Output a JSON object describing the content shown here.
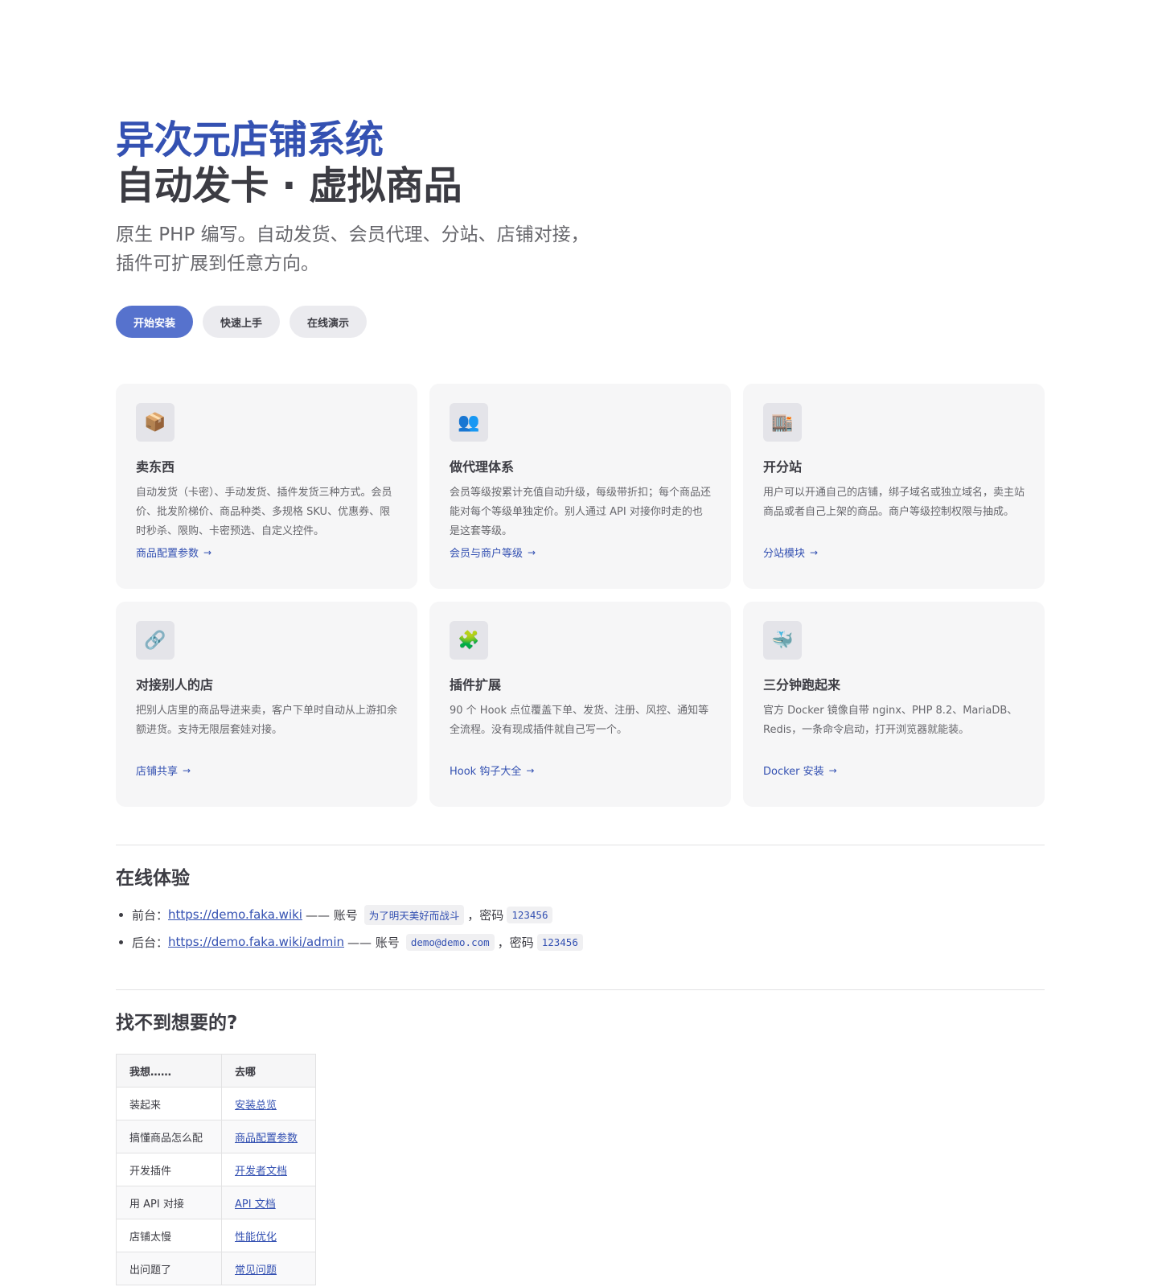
{
  "hero": {
    "name": "异次元店铺系统",
    "text": "自动发卡 · 虚拟商品",
    "tagline": "原生 PHP 编写。自动发货、会员代理、分站、店铺对接，插件可扩展到任意方向。",
    "actions": [
      {
        "label": "开始安装",
        "theme": "brand"
      },
      {
        "label": "快速上手",
        "theme": "alt"
      },
      {
        "label": "在线演示",
        "theme": "alt"
      }
    ]
  },
  "features": [
    {
      "icon": "📦",
      "icon_name": "package-icon",
      "title": "卖东西",
      "details": "自动发货（卡密）、手动发货、插件发货三种方式。会员价、批发阶梯价、商品种类、多规格 SKU、优惠券、限时秒杀、限购、卡密预选、自定义控件。",
      "link": "商品配置参数"
    },
    {
      "icon": "👥",
      "icon_name": "people-icon",
      "title": "做代理体系",
      "details": "会员等级按累计充值自动升级，每级带折扣；每个商品还能对每个等级单独定价。别人通过 API 对接你时走的也是这套等级。",
      "link": "会员与商户等级"
    },
    {
      "icon": "🏬",
      "icon_name": "store-icon",
      "title": "开分站",
      "details": "用户可以开通自己的店铺，绑子域名或独立域名，卖主站商品或者自己上架的商品。商户等级控制权限与抽成。",
      "link": "分站模块"
    },
    {
      "icon": "🔗",
      "icon_name": "link-icon",
      "title": "对接别人的店",
      "details": "把别人店里的商品导进来卖，客户下单时自动从上游扣余额进货。支持无限层套娃对接。",
      "link": "店铺共享"
    },
    {
      "icon": "🧩",
      "icon_name": "puzzle-icon",
      "title": "插件扩展",
      "details": "90 个 Hook 点位覆盖下单、发货、注册、风控、通知等全流程。没有现成插件就自己写一个。",
      "link": "Hook 钩子大全"
    },
    {
      "icon": "🐳",
      "icon_name": "whale-icon",
      "title": "三分钟跑起来",
      "details": "官方 Docker 镜像自带 nginx、PHP 8.2、MariaDB、Redis，一条命令启动，打开浏览器就能装。",
      "link": "Docker 安装"
    }
  ],
  "demo": {
    "title": "在线体验",
    "items": [
      {
        "label": "前台：",
        "url": "https://demo.faka.wiki",
        "dash": "—— 账号",
        "account": "为了明天美好而战斗",
        "comma": "，",
        "pw_label": "密码",
        "password": "123456"
      },
      {
        "label": "后台：",
        "url": "https://demo.faka.wiki/admin",
        "dash": "—— 账号",
        "account": "demo@demo.com",
        "comma": "，",
        "pw_label": "密码",
        "password": "123456"
      }
    ]
  },
  "help": {
    "title": "找不到想要的?",
    "headers": [
      "我想……",
      "去哪"
    ],
    "rows": [
      [
        "装起来",
        "安装总览"
      ],
      [
        "搞懂商品怎么配",
        "商品配置参数"
      ],
      [
        "开发插件",
        "开发者文档"
      ],
      [
        "用 API 对接",
        "API 文档"
      ],
      [
        "店铺太慢",
        "性能优化"
      ],
      [
        "出问题了",
        "常见问题"
      ]
    ]
  }
}
